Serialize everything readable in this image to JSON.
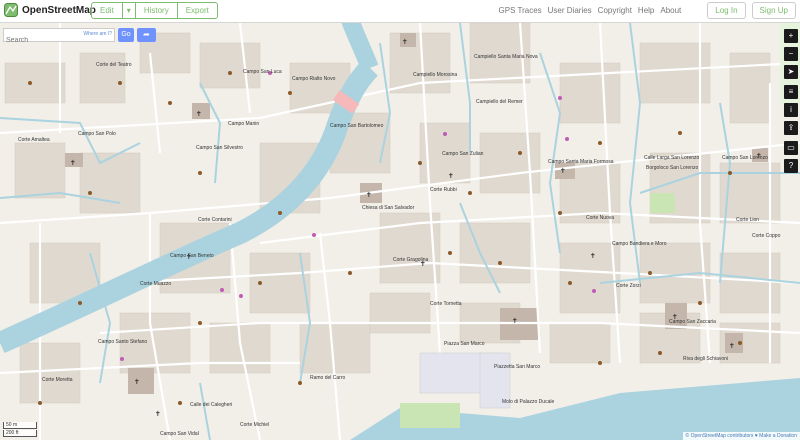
{
  "app": {
    "name": "OpenStreetMap"
  },
  "header": {
    "edit_label": "Edit",
    "history_label": "History",
    "export_label": "Export",
    "nav_links": [
      "GPS Traces",
      "User Diaries",
      "Copyright",
      "Help",
      "About"
    ],
    "login_label": "Log In",
    "signup_label": "Sign Up"
  },
  "search": {
    "placeholder": "Search",
    "where_label": "Where am I?",
    "go_label": "Go"
  },
  "map": {
    "water_color": "#aad3df",
    "labels": [
      "Corte del Teatro",
      "Campo San Luca",
      "Campo Manin",
      "Campo Rialto Novo",
      "Campo San Polo",
      "Corte Amaltea",
      "Campo San Silvestro",
      "Campo San Bartolomeo",
      "Campiello Morosina",
      "Campiello Santa Maria Nova",
      "Campiello del Remer",
      "Chiesa di San Salvador",
      "Campo San Zulian",
      "Corte Rubbi",
      "Campo San Beneto",
      "Campo Santo Stefano",
      "Corte Gragolina",
      "Corte Tornetta",
      "Piazza San Marco",
      "Piazzetta San Marco",
      "Molo di Palazzo Ducale",
      "Riva degli Schiavoni",
      "Campo San Zaccaria",
      "Campo Santa Maria Formosa",
      "Corte Nuova",
      "Campo Bandiera e Moro",
      "Corte Lion",
      "Corte Coppo",
      "Calle Larga San Lorenzo",
      "Borgoloco San Lorenzo",
      "Campo San Lorenzo",
      "Corte Moretta",
      "Corte Michiel",
      "Calle dei Calegheri",
      "Campo San Vidal",
      "Corte Contarini",
      "Corte Muazzo",
      "Ramo del Carro",
      "Corte Zorzi"
    ]
  },
  "scale": {
    "meters": "50 m",
    "feet": "200 ft"
  },
  "attribution": {
    "owner": "© OpenStreetMap contributors",
    "donate": "♥ Make a Donation"
  }
}
